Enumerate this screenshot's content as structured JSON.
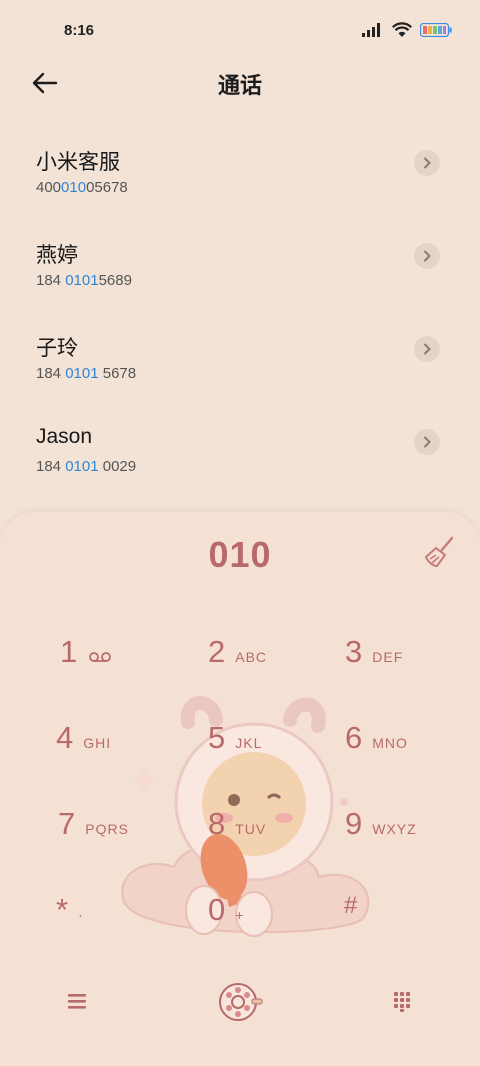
{
  "status": {
    "time": "8:16"
  },
  "header": {
    "title": "通话"
  },
  "contacts": [
    {
      "name": "小米客服",
      "num_pre": "400",
      "num_hl": "010",
      "num_post": "05678"
    },
    {
      "name": "燕婷",
      "num_pre": "184 ",
      "num_hl": "0101",
      "num_post": "5689"
    },
    {
      "name": "子玲",
      "num_pre": "184 ",
      "num_hl": "0101",
      "num_post": " 5678"
    },
    {
      "name": "Jason",
      "num_pre": "184 ",
      "num_hl": "0101",
      "num_post": " 0029"
    }
  ],
  "dialer": {
    "entered": "010",
    "keys": [
      {
        "d": "1",
        "l": ""
      },
      {
        "d": "2",
        "l": "ABC"
      },
      {
        "d": "3",
        "l": "DEF"
      },
      {
        "d": "4",
        "l": "GHI"
      },
      {
        "d": "5",
        "l": "JKL"
      },
      {
        "d": "6",
        "l": "MNO"
      },
      {
        "d": "7",
        "l": "PQRS"
      },
      {
        "d": "8",
        "l": "TUV"
      },
      {
        "d": "9",
        "l": "WXYZ"
      },
      {
        "d": "*",
        "l": "·"
      },
      {
        "d": "0",
        "l": "+"
      },
      {
        "d": "#",
        "l": ""
      }
    ]
  },
  "icons": [
    "back-arrow-icon",
    "chevron-right-icon",
    "broom-icon",
    "voicemail-icon",
    "menu-icon",
    "call-dial-icon",
    "keypad-icon"
  ],
  "colors": {
    "accent": "#b86a6a",
    "highlight": "#2f86d6",
    "background": "#f3e3d6"
  }
}
